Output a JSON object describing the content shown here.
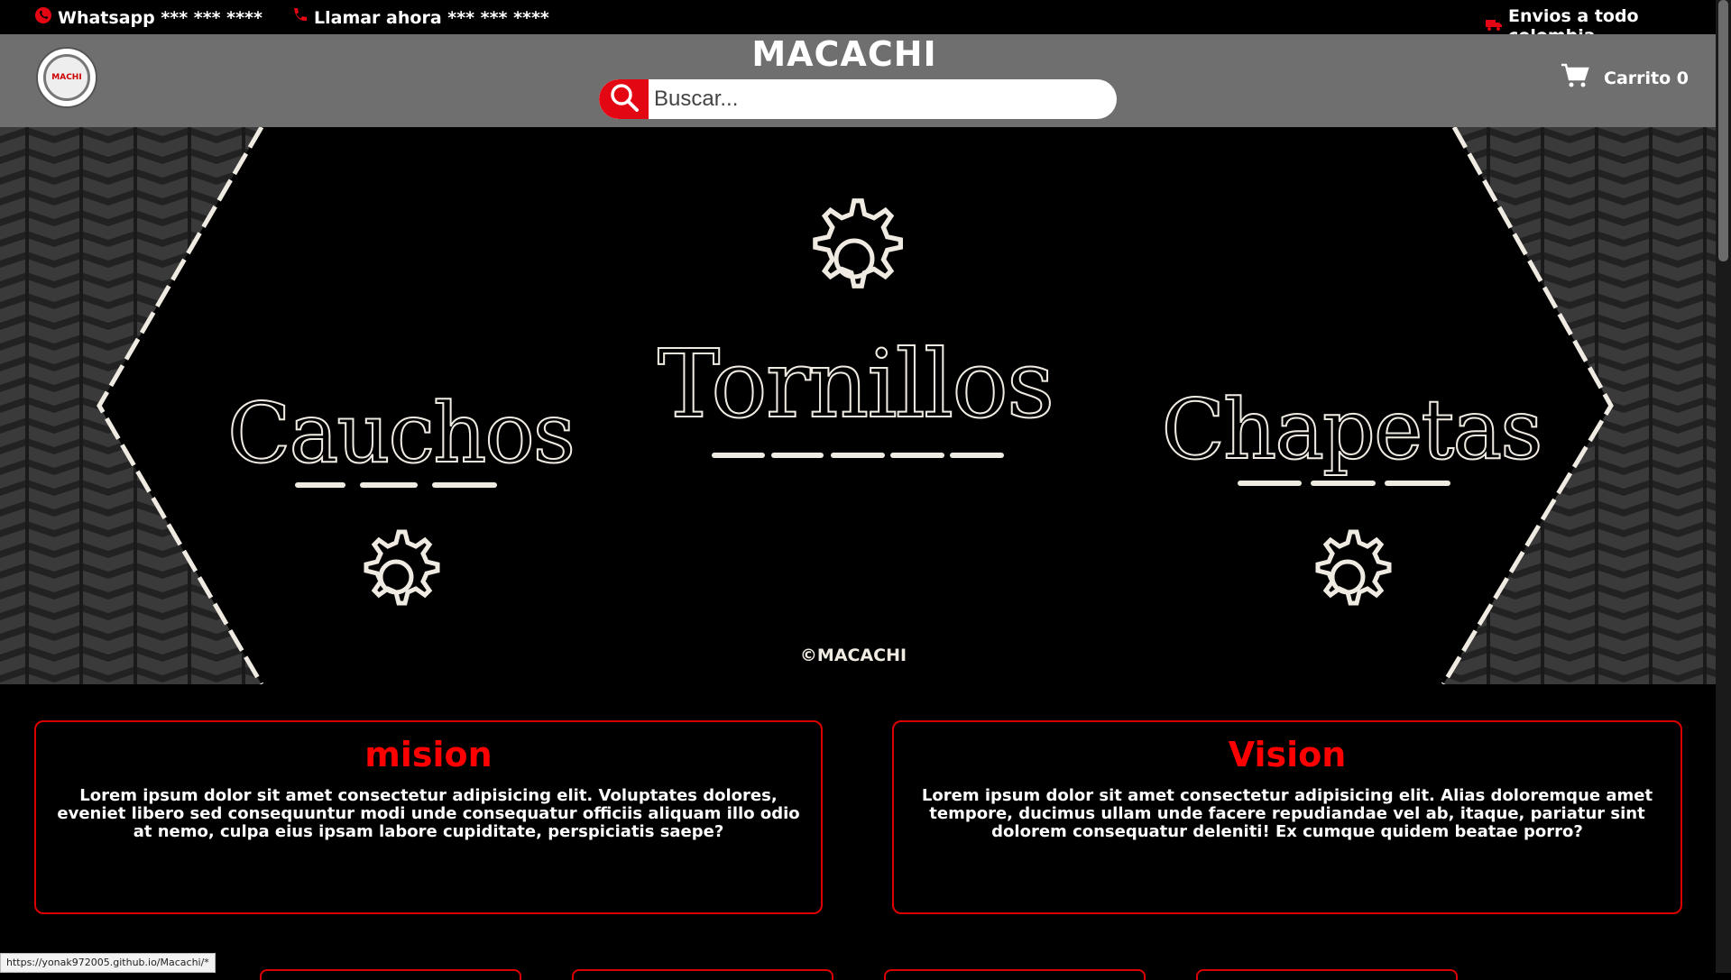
{
  "topbar": {
    "whatsapp": "Whatsapp *** *** ****",
    "call": "Llamar ahora *** *** ****",
    "shipping": "Envios a todo colombia"
  },
  "header": {
    "brand": "MACACHI",
    "logo_text": "MACHI",
    "search_placeholder": "Buscar...",
    "cart_label": "Carrito 0"
  },
  "hero": {
    "left_word": "Cauchos",
    "center_word": "Tornillos",
    "right_word": "Chapetas",
    "copyright": "©MACACHI"
  },
  "cards": [
    {
      "title": "mision",
      "text": "Lorem ipsum dolor sit amet consectetur adipisicing elit. Voluptates dolores, eveniet libero sed consequuntur modi unde consequatur officiis aliquam illo odio at nemo, culpa eius ipsam labore cupiditate, perspiciatis saepe?"
    },
    {
      "title": "Vision",
      "text": "Lorem ipsum dolor sit amet consectetur adipisicing elit. Alias doloremque amet tempore, ducimus ullam unde facere repudiandae vel ab, itaque, pariatur sint dolorem consequatur deleniti! Ex cumque quidem beatae porro?"
    }
  ],
  "statusbar": {
    "url": "https://yonak972005.github.io/Macachi/*"
  },
  "colors": {
    "accent_red": "#e30613",
    "header_gray": "#6f6f6f",
    "hero_ink": "#f0ebe2"
  }
}
